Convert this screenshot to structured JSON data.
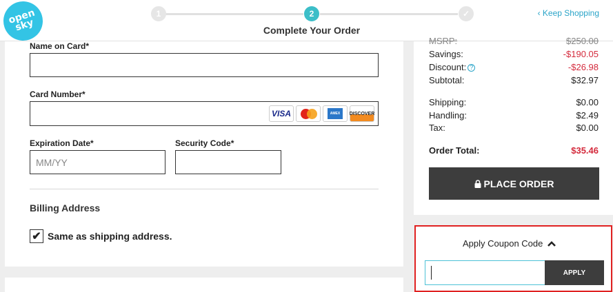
{
  "header": {
    "logo_line1": "open",
    "logo_line2": "sky",
    "steps": [
      {
        "label": "1",
        "state": "inactive"
      },
      {
        "label": "2",
        "state": "active"
      },
      {
        "label": "✓",
        "state": "inactive"
      }
    ],
    "current_step_label": "Complete Your Order",
    "keep_shopping": "‹ Keep Shopping"
  },
  "payment_form": {
    "name_label": "Name on Card*",
    "name_value": "",
    "card_number_label": "Card Number*",
    "card_number_value": "",
    "card_brands": [
      "VISA",
      "MasterCard",
      "AMEX",
      "DISCOVER"
    ],
    "expiration_label": "Expiration Date*",
    "expiration_placeholder": "MM/YY",
    "security_label": "Security Code*",
    "security_value": "",
    "billing_heading": "Billing Address",
    "same_as_shipping_label": "Same as shipping address.",
    "same_as_shipping_checked": true
  },
  "summary": {
    "msrp_label": "MSRP:",
    "msrp_value": "$250.00",
    "savings_label": "Savings:",
    "savings_value": "-$190.05",
    "discount_label": "Discount:",
    "discount_help": "?",
    "discount_value": "-$26.98",
    "subtotal_label": "Subtotal:",
    "subtotal_value": "$32.97",
    "shipping_label": "Shipping:",
    "shipping_value": "$0.00",
    "handling_label": "Handling:",
    "handling_value": "$2.49",
    "tax_label": "Tax:",
    "tax_value": "$0.00",
    "total_label": "Order Total:",
    "total_value": "$35.46",
    "place_order_label": "PLACE ORDER",
    "place_order_icon": "lock-icon"
  },
  "coupon": {
    "toggle_label": "Apply Coupon Code",
    "toggle_icon": "chevron-up-icon",
    "input_value": "",
    "apply_label": "APPLY"
  },
  "colors": {
    "brand": "#33c4e5",
    "step_active": "#3cbec8",
    "link": "#2aa4c8",
    "negative": "#d42a3c",
    "button_dark": "#3d3d3d",
    "highlight_border": "#e02020"
  }
}
